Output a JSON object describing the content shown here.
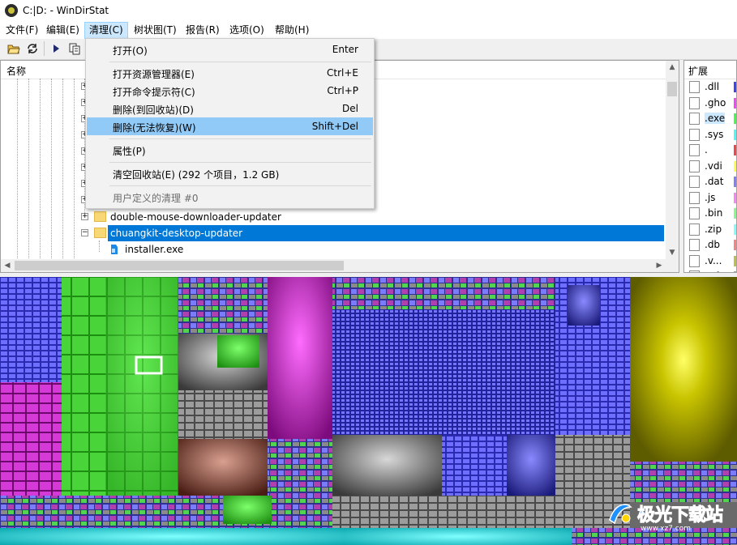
{
  "window": {
    "title": "C:|D: - WinDirStat"
  },
  "menubar": [
    {
      "label": "文件(F)",
      "active": false
    },
    {
      "label": "编辑(E)",
      "active": false
    },
    {
      "label": "清理(C)",
      "active": true
    },
    {
      "label": "树状图(T)",
      "active": false
    },
    {
      "label": "报告(R)",
      "active": false
    },
    {
      "label": "选项(O)",
      "active": false
    },
    {
      "label": "帮助(H)",
      "active": false
    }
  ],
  "toolbar": {
    "icons": [
      "open-icon",
      "refresh-icon",
      "play-icon",
      "copy-icon"
    ]
  },
  "tree": {
    "column_name": "名称",
    "rows": [
      {
        "label": "double-mouse-downloader-updater",
        "expander": "+",
        "selected": false
      },
      {
        "label": "chuangkit-desktop-updater",
        "expander": "−",
        "selected": true
      },
      {
        "label": "installer.exe",
        "expander": "",
        "selected": false
      }
    ]
  },
  "dropdown": {
    "items": [
      {
        "label": "打开(O)",
        "shortcut": "Enter",
        "highlighted": false,
        "disabled": false
      },
      {
        "label": "打开资源管理器(E)",
        "shortcut": "Ctrl+E",
        "highlighted": false,
        "disabled": false
      },
      {
        "label": "打开命令提示符(C)",
        "shortcut": "Ctrl+P",
        "highlighted": false,
        "disabled": false
      },
      {
        "label": "删除(到回收站)(D)",
        "shortcut": "Del",
        "highlighted": false,
        "disabled": false
      },
      {
        "label": "删除(无法恢复)(W)",
        "shortcut": "Shift+Del",
        "highlighted": true,
        "disabled": false
      },
      {
        "label": "属性(P)",
        "shortcut": "",
        "highlighted": false,
        "disabled": false
      },
      {
        "label": "清空回收站(E) (292 个项目，1.2 GB)",
        "shortcut": "",
        "highlighted": false,
        "disabled": false
      },
      {
        "label": "用户定义的清理 #0",
        "shortcut": "",
        "highlighted": false,
        "disabled": true
      }
    ]
  },
  "extensions": {
    "column": "扩展",
    "rows": [
      {
        "ext": ".dll",
        "color": "#4040ff",
        "selected": false
      },
      {
        "ext": ".gho",
        "color": "#ff40ff",
        "selected": false
      },
      {
        "ext": ".exe",
        "color": "#40ff40",
        "selected": true
      },
      {
        "ext": ".sys",
        "color": "#40ffff",
        "selected": false
      },
      {
        "ext": ".",
        "color": "#ff4040",
        "selected": false
      },
      {
        "ext": ".vdi",
        "color": "#ffff40",
        "selected": false
      },
      {
        "ext": ".dat",
        "color": "#8080ff",
        "selected": false
      },
      {
        "ext": ".js",
        "color": "#ff80ff",
        "selected": false
      },
      {
        "ext": ".bin",
        "color": "#80ff80",
        "selected": false
      },
      {
        "ext": ".zip",
        "color": "#80ffff",
        "selected": false
      },
      {
        "ext": ".db",
        "color": "#ff8080",
        "selected": false
      },
      {
        "ext": ".v...",
        "color": "#c0c040",
        "selected": false
      },
      {
        "ext": ".ttf",
        "color": "#a0a0a0",
        "selected": false
      }
    ]
  },
  "watermark": {
    "text": "极光下载站",
    "sub": "www.xz7.com"
  }
}
